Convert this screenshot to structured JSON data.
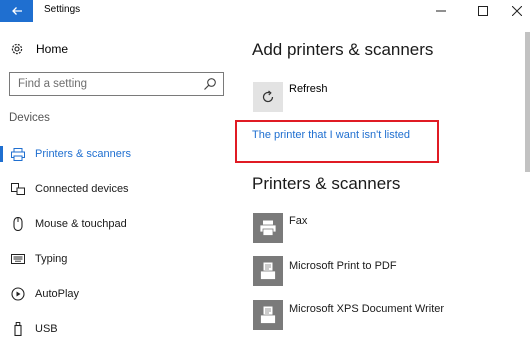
{
  "window": {
    "title": "Settings",
    "accent": "#1f6fd0"
  },
  "sidebar": {
    "home_label": "Home",
    "search_placeholder": "Find a setting",
    "section_label": "Devices",
    "items": [
      {
        "label": "Printers & scanners",
        "icon": "printer-icon",
        "active": true
      },
      {
        "label": "Connected devices",
        "icon": "connected-devices-icon",
        "active": false
      },
      {
        "label": "Mouse & touchpad",
        "icon": "mouse-icon",
        "active": false
      },
      {
        "label": "Typing",
        "icon": "keyboard-icon",
        "active": false
      },
      {
        "label": "AutoPlay",
        "icon": "autoplay-icon",
        "active": false
      },
      {
        "label": "USB",
        "icon": "usb-icon",
        "active": false
      }
    ]
  },
  "main": {
    "add_heading": "Add printers & scanners",
    "refresh_label": "Refresh",
    "missing_link": "The printer that I want isn't listed",
    "list_heading": "Printers & scanners",
    "printers": [
      {
        "label": "Fax",
        "icon": "fax-icon"
      },
      {
        "label": "Microsoft Print to PDF",
        "icon": "printer-document-icon"
      },
      {
        "label": "Microsoft XPS Document Writer",
        "icon": "printer-document-icon"
      }
    ],
    "highlight_color": "#e01b24"
  }
}
